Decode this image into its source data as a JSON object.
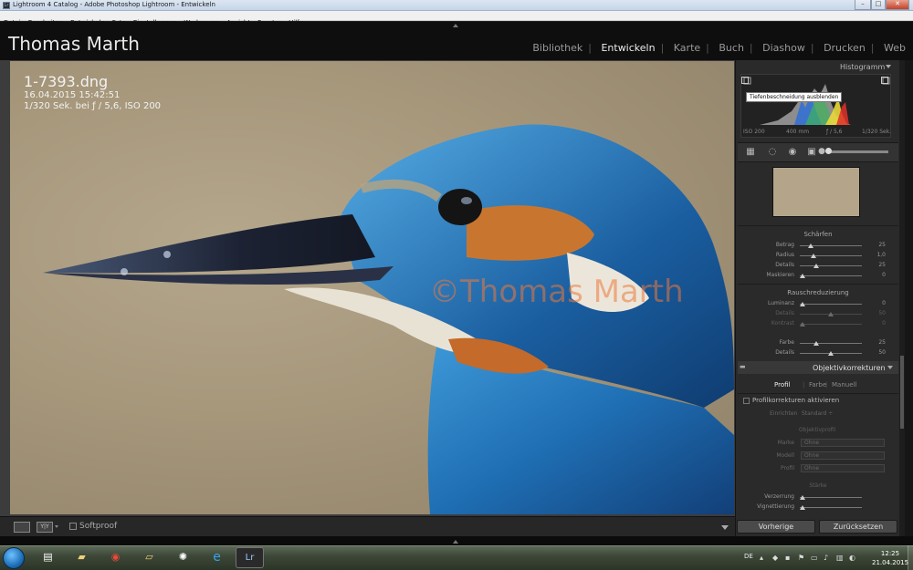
{
  "window": {
    "title": "Lightroom 4 Catalog - Adobe Photoshop Lightroom - Entwickeln",
    "icon": "Lr",
    "controls": [
      "–",
      "□",
      "✕"
    ]
  },
  "menu": [
    "Datei",
    "Bearbeiten",
    "Entwickeln",
    "Foto",
    "Einstellungen",
    "Werkzeuge",
    "Ansicht",
    "Fenster",
    "Hilfe"
  ],
  "identity_plate": "Thomas Marth",
  "modules": [
    {
      "label": "Bibliothek",
      "active": false
    },
    {
      "label": "Entwickeln",
      "active": true
    },
    {
      "label": "Karte",
      "active": false
    },
    {
      "label": "Buch",
      "active": false
    },
    {
      "label": "Diashow",
      "active": false
    },
    {
      "label": "Drucken",
      "active": false
    },
    {
      "label": "Web",
      "active": false
    }
  ],
  "photo_info": {
    "filename": "1-7393.dng",
    "datetime": "16.04.2015 15:42:51",
    "exposure": "1/320 Sek. bei ƒ / 5,6, ISO 200"
  },
  "watermark": "©Thomas Marth",
  "histogram": {
    "title": "Histogramm",
    "tooltip": "Tiefenbeschneidung ausblenden",
    "iso": "ISO 200",
    "focal": "400 mm",
    "aperture": "ƒ / 5,6",
    "shutter": "1/320 Sek."
  },
  "sharpen": {
    "title": "Schärfen",
    "sliders": [
      {
        "label": "Betrag",
        "value": "25",
        "pos": 0.18,
        "dim": false
      },
      {
        "label": "Radius",
        "value": "1,0",
        "pos": 0.22,
        "dim": false
      },
      {
        "label": "Details",
        "value": "25",
        "pos": 0.27,
        "dim": false
      },
      {
        "label": "Maskieren",
        "value": "0",
        "pos": 0.04,
        "dim": false
      }
    ]
  },
  "noise": {
    "title": "Rauschreduzierung",
    "sliders": [
      {
        "label": "Luminanz",
        "value": "0",
        "pos": 0.04,
        "dim": false
      },
      {
        "label": "Details",
        "value": "50",
        "pos": 0.5,
        "dim": true
      },
      {
        "label": "Kontrast",
        "value": "0",
        "pos": 0.04,
        "dim": true
      },
      {
        "label": "Farbe",
        "value": "25",
        "pos": 0.27,
        "dim": false
      },
      {
        "label": "Details",
        "value": "50",
        "pos": 0.5,
        "dim": false
      }
    ]
  },
  "lens": {
    "title": "Objektivkorrekturen",
    "tabs": [
      {
        "label": "Profil",
        "active": true
      },
      {
        "label": "Farbe",
        "active": false
      },
      {
        "label": "Manuell",
        "active": false
      }
    ],
    "enable_profile": "Profilkorrekturen aktivieren",
    "setup_label": "Einrichten",
    "setup_value": "Standard ÷",
    "profile_group": "Objektivprofil",
    "fields": [
      {
        "label": "Marke",
        "value": "Ohne"
      },
      {
        "label": "Modell",
        "value": "Ohne"
      },
      {
        "label": "Profil",
        "value": "Ohne"
      }
    ],
    "amount_title": "Stärke",
    "amount_sliders": [
      {
        "label": "Verzerrung",
        "pos": 0.04
      },
      {
        "label": "Vignettierung",
        "pos": 0.04
      }
    ]
  },
  "buttons": {
    "previous": "Vorherige",
    "reset": "Zurücksetzen"
  },
  "toolbar": {
    "softproof": "Softproof",
    "compare_label": "Y|Y"
  },
  "taskbar": {
    "apps": [
      {
        "name": "notepad",
        "glyph": "▤"
      },
      {
        "name": "explorer",
        "glyph": "▰"
      },
      {
        "name": "chrome",
        "glyph": "◉"
      },
      {
        "name": "folder",
        "glyph": "▱"
      },
      {
        "name": "app",
        "glyph": "✺"
      },
      {
        "name": "ie",
        "glyph": "e"
      },
      {
        "name": "lightroom",
        "glyph": "Lr"
      }
    ],
    "lang": "DE",
    "time": "12:25",
    "date": "21.04.2015"
  },
  "colors": {
    "panel": "#2a2a2a",
    "background": "#1e1e1e",
    "accent_watermark": "#eb783c",
    "bird_blue": "#1f6fb4",
    "bird_orange": "#c8762f"
  }
}
